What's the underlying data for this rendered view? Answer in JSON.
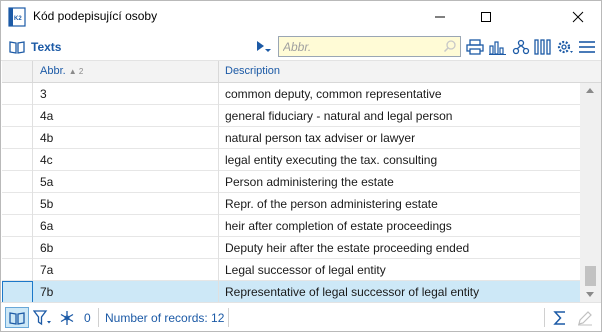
{
  "window": {
    "title": "Kód podepisující osoby",
    "app_icon": "k2-app-icon",
    "controls": [
      "minimize-icon",
      "maximize-icon",
      "close-icon"
    ]
  },
  "toolbar": {
    "texts_label": "Texts",
    "search_placeholder": "Abbr.",
    "icons": [
      "print-icon",
      "chart-icon",
      "tree-icon",
      "columns-icon",
      "settings-icon",
      "menu-icon"
    ]
  },
  "grid": {
    "columns": [
      {
        "label": "Abbr.",
        "sort": "▲ 2"
      },
      {
        "label": "Description"
      }
    ],
    "rows": [
      {
        "abbr": "3",
        "description": "common deputy, common representative"
      },
      {
        "abbr": "4a",
        "description": "general fiduciary - natural and legal person"
      },
      {
        "abbr": "4b",
        "description": "natural person tax adviser or lawyer"
      },
      {
        "abbr": "4c",
        "description": "legal entity executing the tax. consulting"
      },
      {
        "abbr": "5a",
        "description": "Person administering the estate"
      },
      {
        "abbr": "5b",
        "description": "Repr. of the person administering estate"
      },
      {
        "abbr": "6a",
        "description": "heir after completion of estate proceedings"
      },
      {
        "abbr": "6b",
        "description": "Deputy heir after the estate proceeding ended"
      },
      {
        "abbr": "7a",
        "description": "Legal successor of legal entity"
      },
      {
        "abbr": "7b",
        "description": "Representative of legal successor of legal entity"
      }
    ],
    "selected_row": "7b"
  },
  "status": {
    "filter_count": "0",
    "records_text": "Number of records: 12"
  },
  "colors": {
    "accent": "#1c5aa6",
    "selection": "#cde8f7",
    "search_bg": "#fffbd6"
  }
}
